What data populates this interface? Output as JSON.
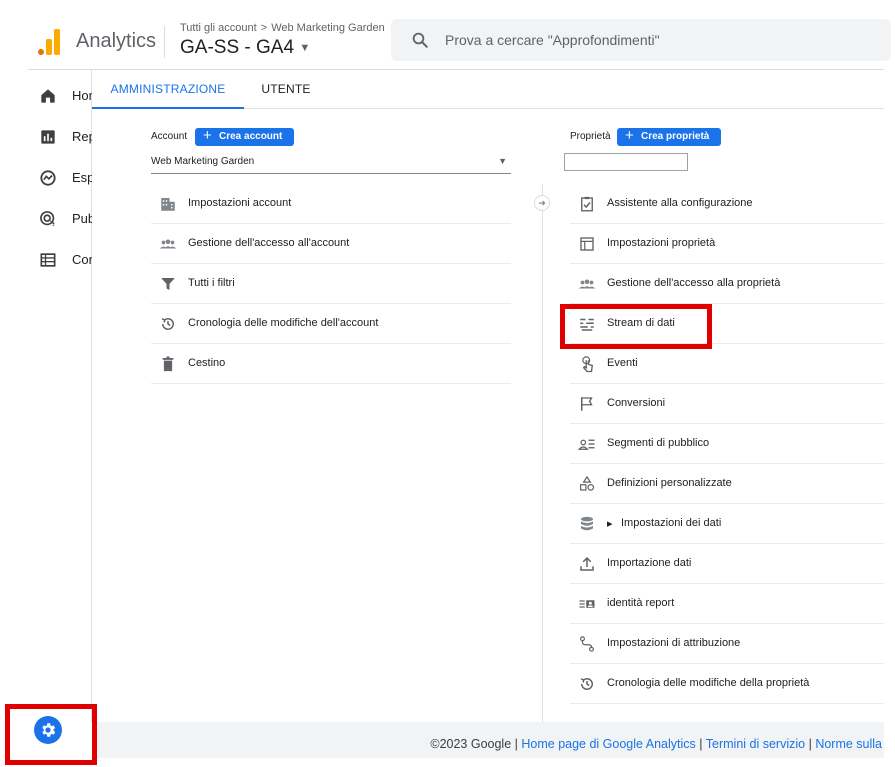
{
  "header": {
    "app_name": "Analytics",
    "breadcrumb_all": "Tutti gli account",
    "breadcrumb_account": "Web Marketing Garden",
    "property_name": "GA-SS - GA4",
    "search_placeholder": "Prova a cercare \"Approfondimenti\""
  },
  "rail": {
    "items": [
      {
        "label": "Home",
        "icon": "home-icon"
      },
      {
        "label": "Report",
        "icon": "reports-icon"
      },
      {
        "label": "Esplora",
        "icon": "explore-icon"
      },
      {
        "label": "Pubblicità",
        "icon": "advertising-icon"
      },
      {
        "label": "Configura",
        "icon": "configure-icon"
      }
    ]
  },
  "tabs": {
    "admin": "AMMINISTRAZIONE",
    "user": "UTENTE"
  },
  "account_column": {
    "label": "Account",
    "create_button": "Crea account",
    "selected_account": "Web Marketing Garden",
    "items": [
      {
        "label": "Impostazioni account",
        "icon": "building-icon"
      },
      {
        "label": "Gestione dell'accesso all'account",
        "icon": "people-icon"
      },
      {
        "label": "Tutti i filtri",
        "icon": "filter-icon"
      },
      {
        "label": "Cronologia delle modifiche dell'account",
        "icon": "history-icon"
      },
      {
        "label": "Cestino",
        "icon": "trash-icon"
      }
    ]
  },
  "property_column": {
    "label": "Proprietà",
    "create_button": "Crea proprietà",
    "items": [
      {
        "label": "Assistente alla configurazione",
        "icon": "checklist-icon"
      },
      {
        "label": "Impostazioni proprietà",
        "icon": "property-settings-icon"
      },
      {
        "label": "Gestione dell'accesso alla proprietà",
        "icon": "people-icon"
      },
      {
        "label": "Stream di dati",
        "icon": "data-streams-icon"
      },
      {
        "label": "Eventi",
        "icon": "touch-icon"
      },
      {
        "label": "Conversioni",
        "icon": "flag-icon"
      },
      {
        "label": "Segmenti di pubblico",
        "icon": "audience-icon"
      },
      {
        "label": "Definizioni personalizzate",
        "icon": "shapes-icon"
      },
      {
        "label": "Impostazioni dei dati",
        "icon": "database-icon"
      },
      {
        "label": "Importazione dati",
        "icon": "upload-icon"
      },
      {
        "label": "identità report",
        "icon": "reporting-identity-icon"
      },
      {
        "label": "Impostazioni di attribuzione",
        "icon": "attribution-icon"
      },
      {
        "label": "Cronologia delle modifiche della proprietà",
        "icon": "history-icon"
      }
    ]
  },
  "footer": {
    "copyright": "©2023 Google",
    "sep": " | ",
    "link_home": "Home page di Google Analytics",
    "link_terms": "Termini di servizio",
    "link_privacy": "Norme sulla"
  },
  "colors": {
    "accent": "#1a73e8",
    "highlight": "#e00000",
    "logo_orange": "#e37400",
    "logo_yellow": "#f9ab00"
  }
}
